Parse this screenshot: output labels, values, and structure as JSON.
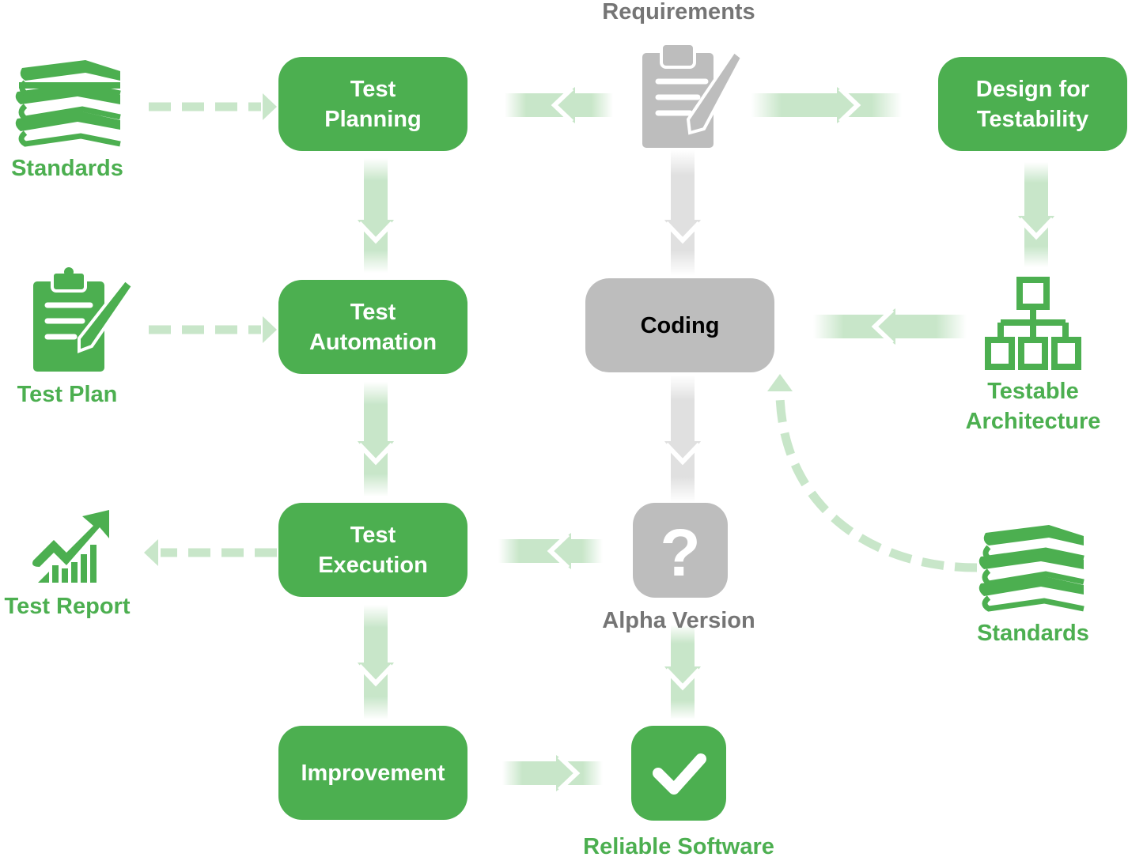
{
  "colors": {
    "green": "#4caf50",
    "light_green": "#c8e6c9",
    "gray": "#bdbdbd",
    "light_gray": "#e0e0e0",
    "label_gray": "#757575"
  },
  "nodes": {
    "test_planning": {
      "line1": "Test",
      "line2": "Planning"
    },
    "test_automation": {
      "line1": "Test",
      "line2": "Automation"
    },
    "test_execution": {
      "line1": "Test",
      "line2": "Execution"
    },
    "improvement": "Improvement",
    "design_for_testability": {
      "line1": "Design for",
      "line2": "Testability"
    },
    "coding": "Coding"
  },
  "labels": {
    "requirements": "Requirements",
    "standards_left": "Standards",
    "test_plan": "Test Plan",
    "test_report": "Test Report",
    "testable_architecture": {
      "line1": "Testable",
      "line2": "Architecture"
    },
    "standards_right": "Standards",
    "alpha_version": "Alpha Version",
    "reliable_software": "Reliable Software"
  },
  "icons": {
    "standards_left": "books-icon",
    "test_plan": "clipboard-pencil-icon",
    "test_report": "growth-chart-icon",
    "requirements": "clipboard-pencil-icon",
    "testable_architecture": "hierarchy-icon",
    "standards_right": "books-icon",
    "alpha_version": "question-icon",
    "reliable_software": "checkmark-icon"
  }
}
